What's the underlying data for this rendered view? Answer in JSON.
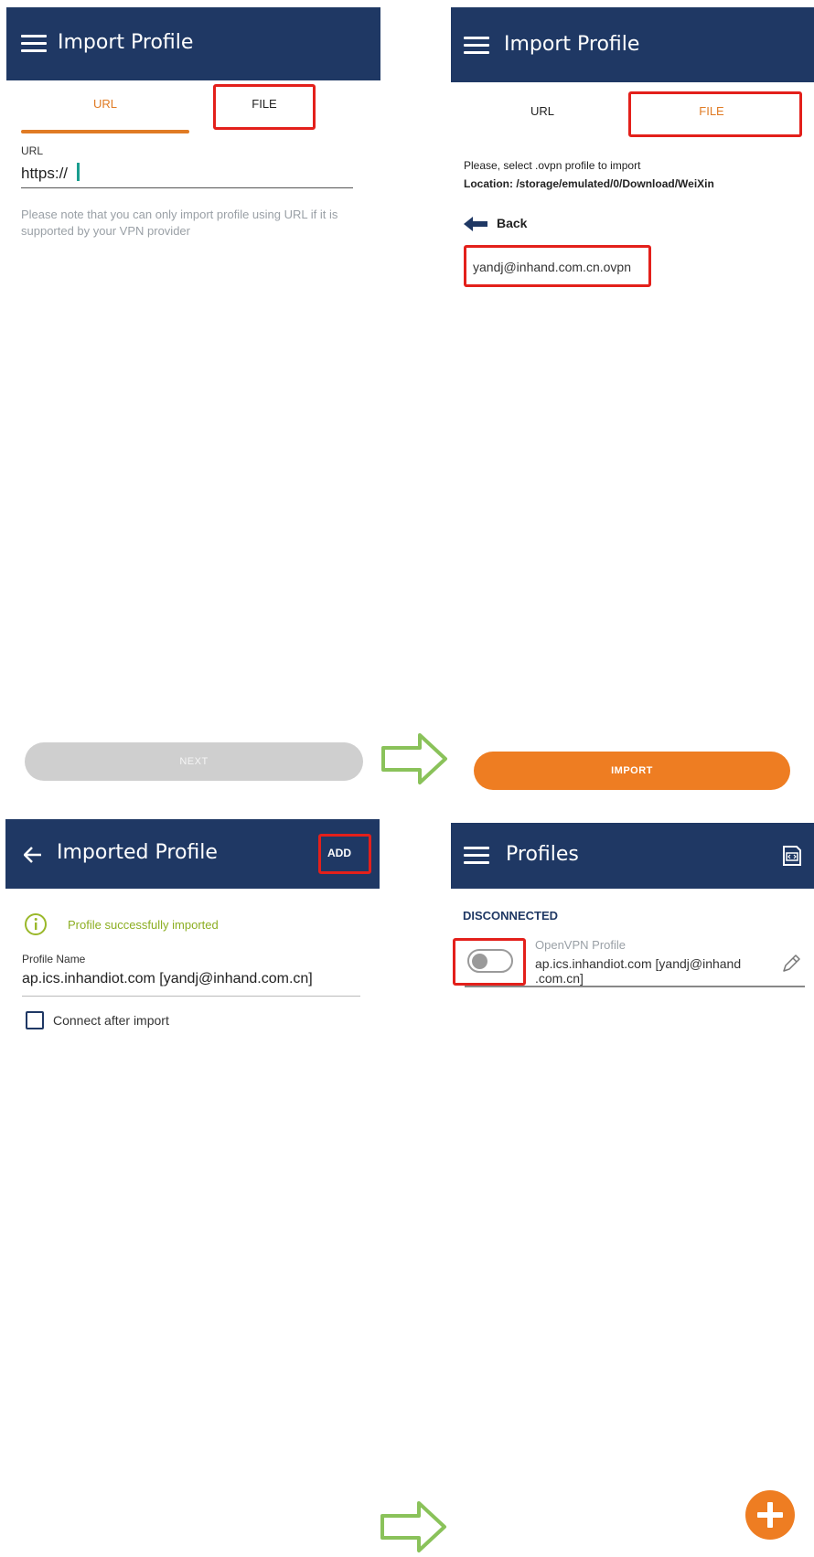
{
  "colors": {
    "appbar": "#1f3864",
    "accent": "#e07b24",
    "highlight": "#e3201b",
    "arrow": "#8ac25a"
  },
  "panel1": {
    "title": "Import Profile",
    "tab_url": "URL",
    "tab_file": "FILE",
    "field_label": "URL",
    "field_value": "https://",
    "note": "Please note that you can only import profile using URL if it is supported by your VPN provider",
    "next_label": "NEXT"
  },
  "panel2": {
    "title": "Import Profile",
    "tab_url": "URL",
    "tab_file": "FILE",
    "instruction": "Please, select .ovpn profile to import",
    "location": "Location: /storage/emulated/0/Download/WeiXin",
    "back_label": "Back",
    "file_name": "yandj@inhand.com.cn.ovpn",
    "import_label": "IMPORT"
  },
  "panel3": {
    "title": "Imported Profile",
    "add_label": "ADD",
    "success_text": "Profile successfully imported",
    "profile_name_label": "Profile Name",
    "profile_name_value": "ap.ics.inhandiot.com [yandj@inhand.com.cn]",
    "connect_after_import": "Connect after import"
  },
  "panel4": {
    "title": "Profiles",
    "status": "DISCONNECTED",
    "profile_type": "OpenVPN Profile",
    "profile_line1": "ap.ics.inhandiot.com [yandj@inhand",
    "profile_line2": ".com.cn]"
  }
}
